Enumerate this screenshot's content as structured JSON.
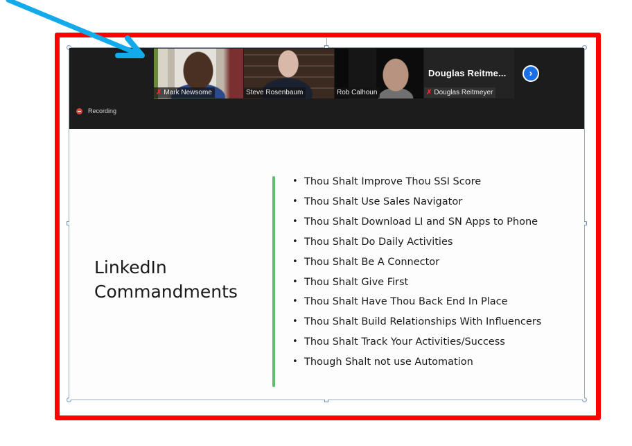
{
  "annotation": {
    "frame_color": "#ff0000",
    "arrow_color": "#12aaeb"
  },
  "zoom_meeting": {
    "participants": [
      {
        "name": "Mark Newsome",
        "muted": true,
        "active_speaker": false
      },
      {
        "name": "Steve Rosenbaum",
        "muted": false,
        "active_speaker": true
      },
      {
        "name": "Rob Calhoun",
        "muted": false,
        "active_speaker": false
      },
      {
        "name": "Douglas Reitmeyer",
        "display_name": "Douglas  Reitme...",
        "muted": true,
        "video_off": true
      }
    ],
    "next_page_icon": "chevron-right-icon",
    "recording_label": "Recording",
    "accent_color": "#1b6fe6"
  },
  "slide": {
    "title_line1": "LinkedIn",
    "title_line2": "Commandments",
    "divider_color": "#5cbf6a",
    "bullet_glyph": "•",
    "bullets": [
      "Thou Shalt Improve Thou SSI Score",
      "Thou Shalt Use Sales Navigator",
      "Thou Shalt Download LI and SN Apps to Phone",
      "Thou Shalt Do Daily Activities",
      "Thou Shalt Be A Connector",
      "Thou Shalt Give First",
      "Thou Shalt Have Thou Back End In Place",
      "Thou Shalt Build Relationships With Influencers",
      "Thou Shalt Track Your Activities/Success",
      "Though Shalt not use Automation"
    ]
  }
}
